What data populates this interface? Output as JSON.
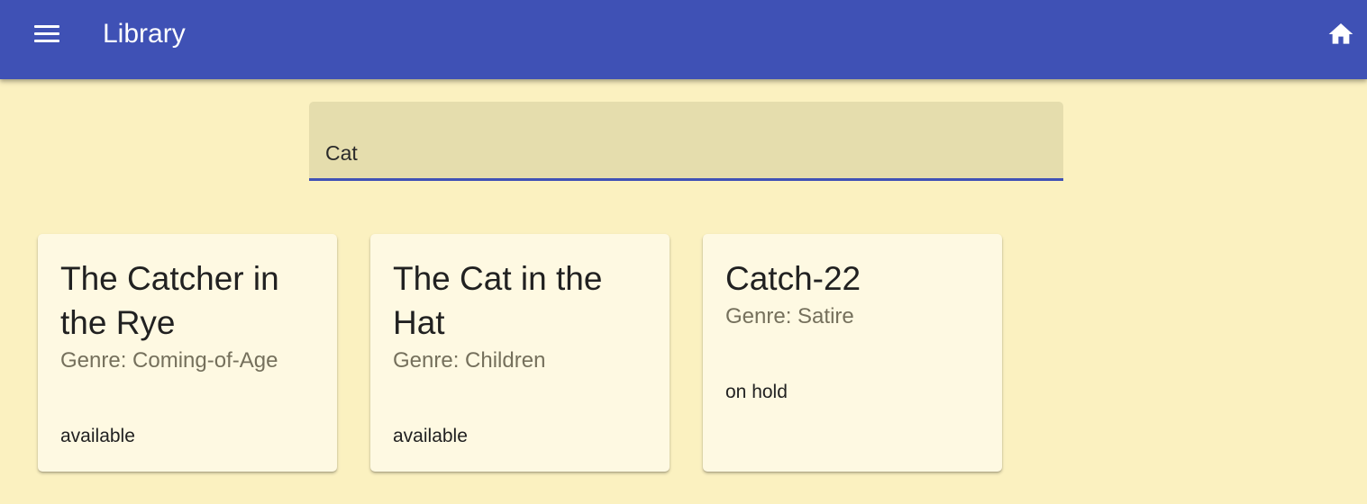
{
  "app_bar": {
    "title": "Library",
    "menu_icon": "hamburger-menu-icon",
    "home_icon": "home-icon",
    "color": "#3F51B5"
  },
  "search": {
    "value": "Cat",
    "underline_color": "#3F51B5"
  },
  "books": [
    {
      "title": "The Catcher in the Rye",
      "genre": "Genre: Coming-of-Age",
      "status": "available"
    },
    {
      "title": "The Cat in the Hat",
      "genre": "Genre: Children",
      "status": "available"
    },
    {
      "title": "Catch-22",
      "genre": "Genre: Satire",
      "status": "on hold"
    }
  ],
  "colors": {
    "background": "#FBF1C0",
    "card_background": "#FEF9E2",
    "search_background": "#E5DDAD",
    "genre_text": "#75705C"
  }
}
